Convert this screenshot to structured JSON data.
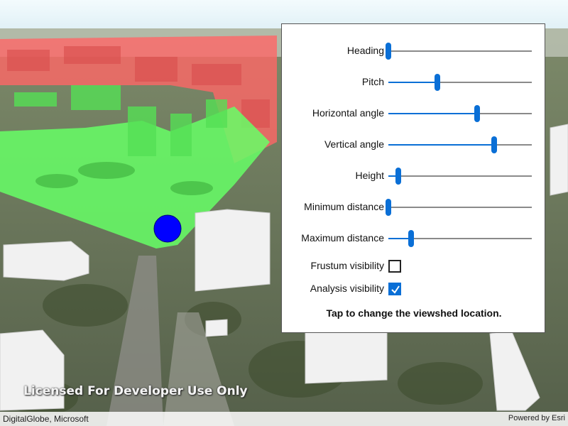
{
  "map": {
    "watermark": "Licensed For Developer Use Only",
    "attribution_left": "DigitalGlobe, Microsoft",
    "attribution_right": "Powered by Esri",
    "visible_color": "#66ff66",
    "hidden_color": "#ff6666",
    "observer_color": "#0000ff"
  },
  "panel": {
    "sliders": [
      {
        "label": "Heading",
        "value": 0
      },
      {
        "label": "Pitch",
        "value": 0.34
      },
      {
        "label": "Horizontal angle",
        "value": 0.617
      },
      {
        "label": "Vertical angle",
        "value": 0.74
      },
      {
        "label": "Height",
        "value": 0.07
      },
      {
        "label": "Minimum distance",
        "value": 0
      },
      {
        "label": "Maximum distance",
        "value": 0.16
      }
    ],
    "checkboxes": [
      {
        "label": "Frustum visibility",
        "checked": false
      },
      {
        "label": "Analysis visibility",
        "checked": true
      }
    ],
    "instruction": "Tap to change the viewshed location."
  }
}
